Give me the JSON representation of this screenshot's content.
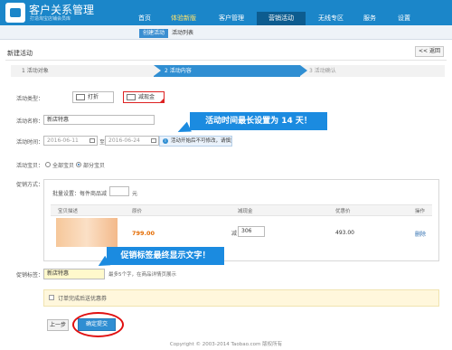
{
  "header": {
    "app_title": "客户关系管理",
    "app_subtitle": "打造淘宝店铺会员库",
    "nav": [
      "首页",
      "体验新版",
      "客户管理",
      "营销活动",
      "无线专区",
      "服务",
      "设置"
    ]
  },
  "subnav": {
    "tabs": [
      "创建活动",
      "活动列表"
    ]
  },
  "page": {
    "title": "新建活动",
    "back_label": "<< 返回"
  },
  "steps": [
    {
      "num": "1",
      "label": "活动对象",
      "state": "done"
    },
    {
      "num": "2",
      "label": "活动内容",
      "state": "active"
    },
    {
      "num": "3",
      "label": "活动确认",
      "state": "todo"
    }
  ],
  "form": {
    "type_label": "活动类型：",
    "type_options": [
      "打折",
      "减现金"
    ],
    "selected_type": "减现金",
    "name_label": "活动名称：",
    "name_value": "新店特惠",
    "time_label": "活动时间：",
    "start_date": "2016-06-11",
    "to_label": "至",
    "end_date": "2016-06-24",
    "date_hint": "活动开始后不可修改，请慎重选择！",
    "scope_label": "活动宝贝：",
    "scope_options": [
      "全部宝贝",
      "部分宝贝"
    ],
    "scope_selected": "部分宝贝",
    "promo_label": "促销方式：",
    "batch_label": "批量设置：每件商品减",
    "batch_unit": "元",
    "table": {
      "headers": [
        "宝贝描述",
        "原价",
        "减现金",
        "优惠价",
        "操作"
      ],
      "rows": [
        {
          "price": "799.00",
          "reduce_prefix": "减",
          "reduce_value": "306",
          "final": "493.00",
          "action": "删除"
        }
      ]
    },
    "tag_label": "促销标签：",
    "tag_value": "新店特惠",
    "tag_hint": "最多5个字，在商品详情页展示",
    "notice_text": "订单完成后送优惠券"
  },
  "callouts": [
    "活动时间最长设置为 14 天！",
    "促销标签最终显示文字！"
  ],
  "buttons": {
    "prev": "上一步",
    "submit": "确定提交"
  },
  "footer": "Copyright © 2003-2014 Taobao.com 版权所有",
  "colors": {
    "header": "#1b86c9",
    "active_nav": "#0d5c8f",
    "step_active": "#2f8ed2",
    "callout": "#1b8be0",
    "highlight": "#e01010"
  }
}
